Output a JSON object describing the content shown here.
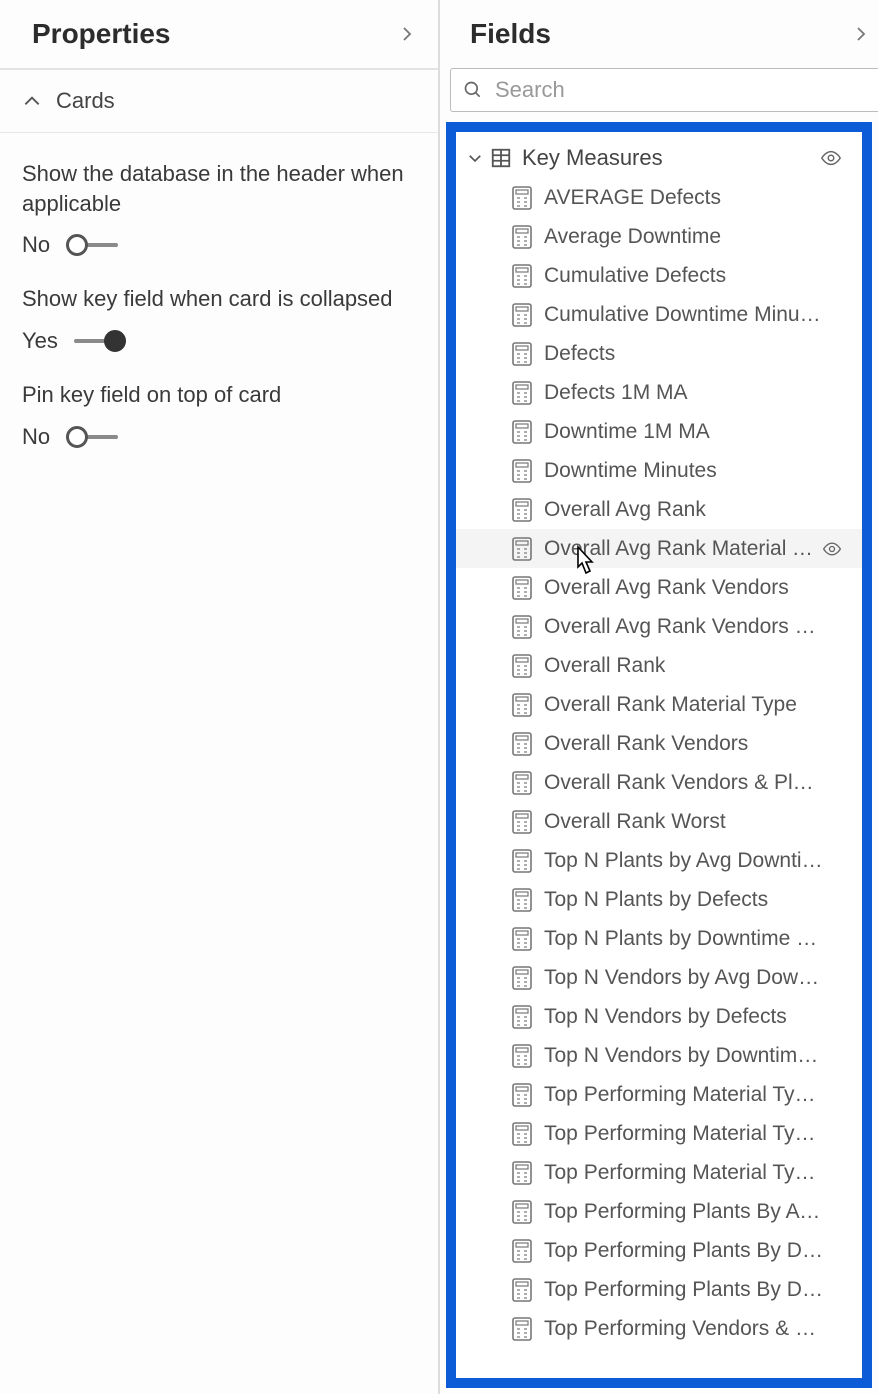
{
  "leftPanel": {
    "title": "Properties",
    "section": "Cards",
    "props": [
      {
        "label": "Show the database in the header when applicable",
        "state": "No",
        "on": false
      },
      {
        "label": "Show key field when card is collapsed",
        "state": "Yes",
        "on": true
      },
      {
        "label": "Pin key field on top of card",
        "state": "No",
        "on": false
      }
    ]
  },
  "rightPanel": {
    "title": "Fields",
    "searchPlaceholder": "Search",
    "tableName": "Key Measures",
    "hoveredIndex": 9,
    "fields": [
      "AVERAGE Defects",
      "Average Downtime",
      "Cumulative Defects",
      "Cumulative Downtime Minutes",
      "Defects",
      "Defects 1M MA",
      "Downtime 1M MA",
      "Downtime Minutes",
      "Overall Avg Rank",
      "Overall Avg Rank Material Type",
      "Overall Avg Rank Vendors",
      "Overall Avg Rank Vendors Pla…",
      "Overall Rank",
      "Overall Rank Material Type",
      "Overall Rank Vendors",
      "Overall Rank Vendors & Plants",
      "Overall Rank Worst",
      "Top N Plants by Avg Downtim…",
      "Top N Plants by Defects",
      "Top N Plants by Downtime Mi…",
      "Top N Vendors by Avg Downt…",
      "Top N Vendors by Defects",
      "Top N Vendors by Downtime …",
      "Top Performing Material Type…",
      "Top Performing Material Type…",
      "Top Performing Material Type…",
      "Top Performing Plants By Avg…",
      "Top Performing Plants By Def…",
      "Top Performing Plants By Do…",
      "Top Performing Vendors & Pl…"
    ]
  }
}
